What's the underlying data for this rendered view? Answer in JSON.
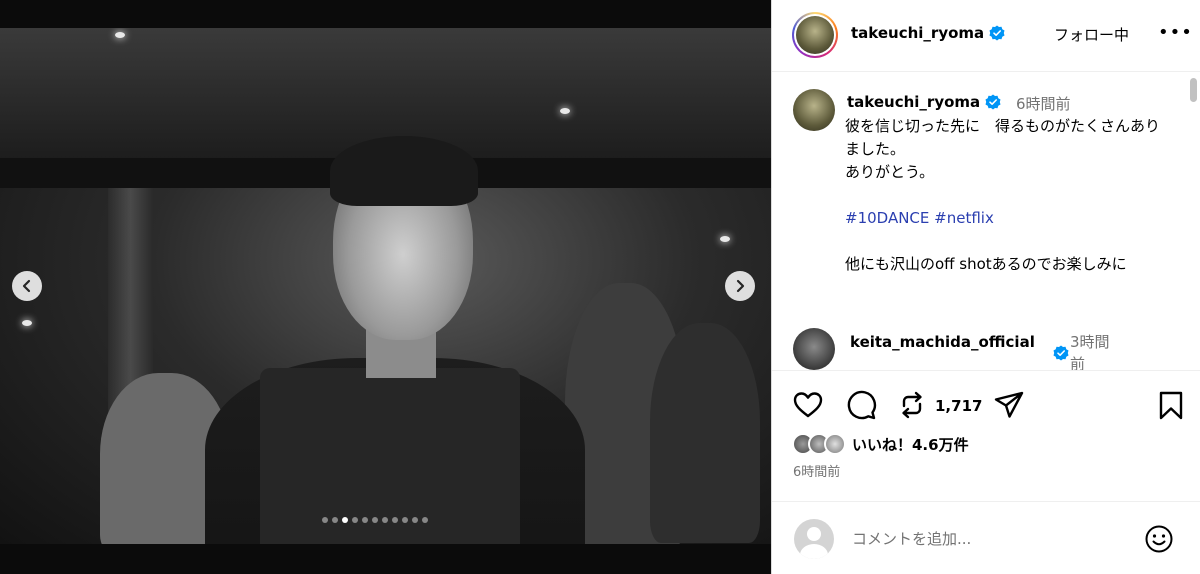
{
  "post": {
    "username": "takeuchi_ryoma",
    "follow_label": "フォロー中",
    "more_label": "•••",
    "caption_time": "6時間前",
    "caption_text": "彼を信じ切った先に　得るものがたくさんありました。\nありがとう。\n\n",
    "hashtags": "#10DANCE #netflix",
    "caption_text_2": "他にも沢山のoff shotあるのでお楽しみに",
    "carousel_total": 11,
    "carousel_active": 3
  },
  "comments": [
    {
      "username": "keita_machida_official",
      "time": "3時間前"
    }
  ],
  "actions": {
    "repost_count": "1,717",
    "likes_label": "いいね！4.6万件",
    "post_time": "6時間前"
  },
  "comment_box": {
    "placeholder": "コメントを追加..."
  },
  "colors": {
    "verified": "#0095f6",
    "secondary_text": "#737373",
    "hashtag": "#2b3fb0"
  },
  "icons": {
    "prev": "chevron-left-icon",
    "next": "chevron-right-icon",
    "like": "heart-icon",
    "comment": "comment-icon",
    "repost": "repost-icon",
    "share": "paper-plane-icon",
    "save": "bookmark-icon",
    "emoji": "smiley-icon"
  }
}
